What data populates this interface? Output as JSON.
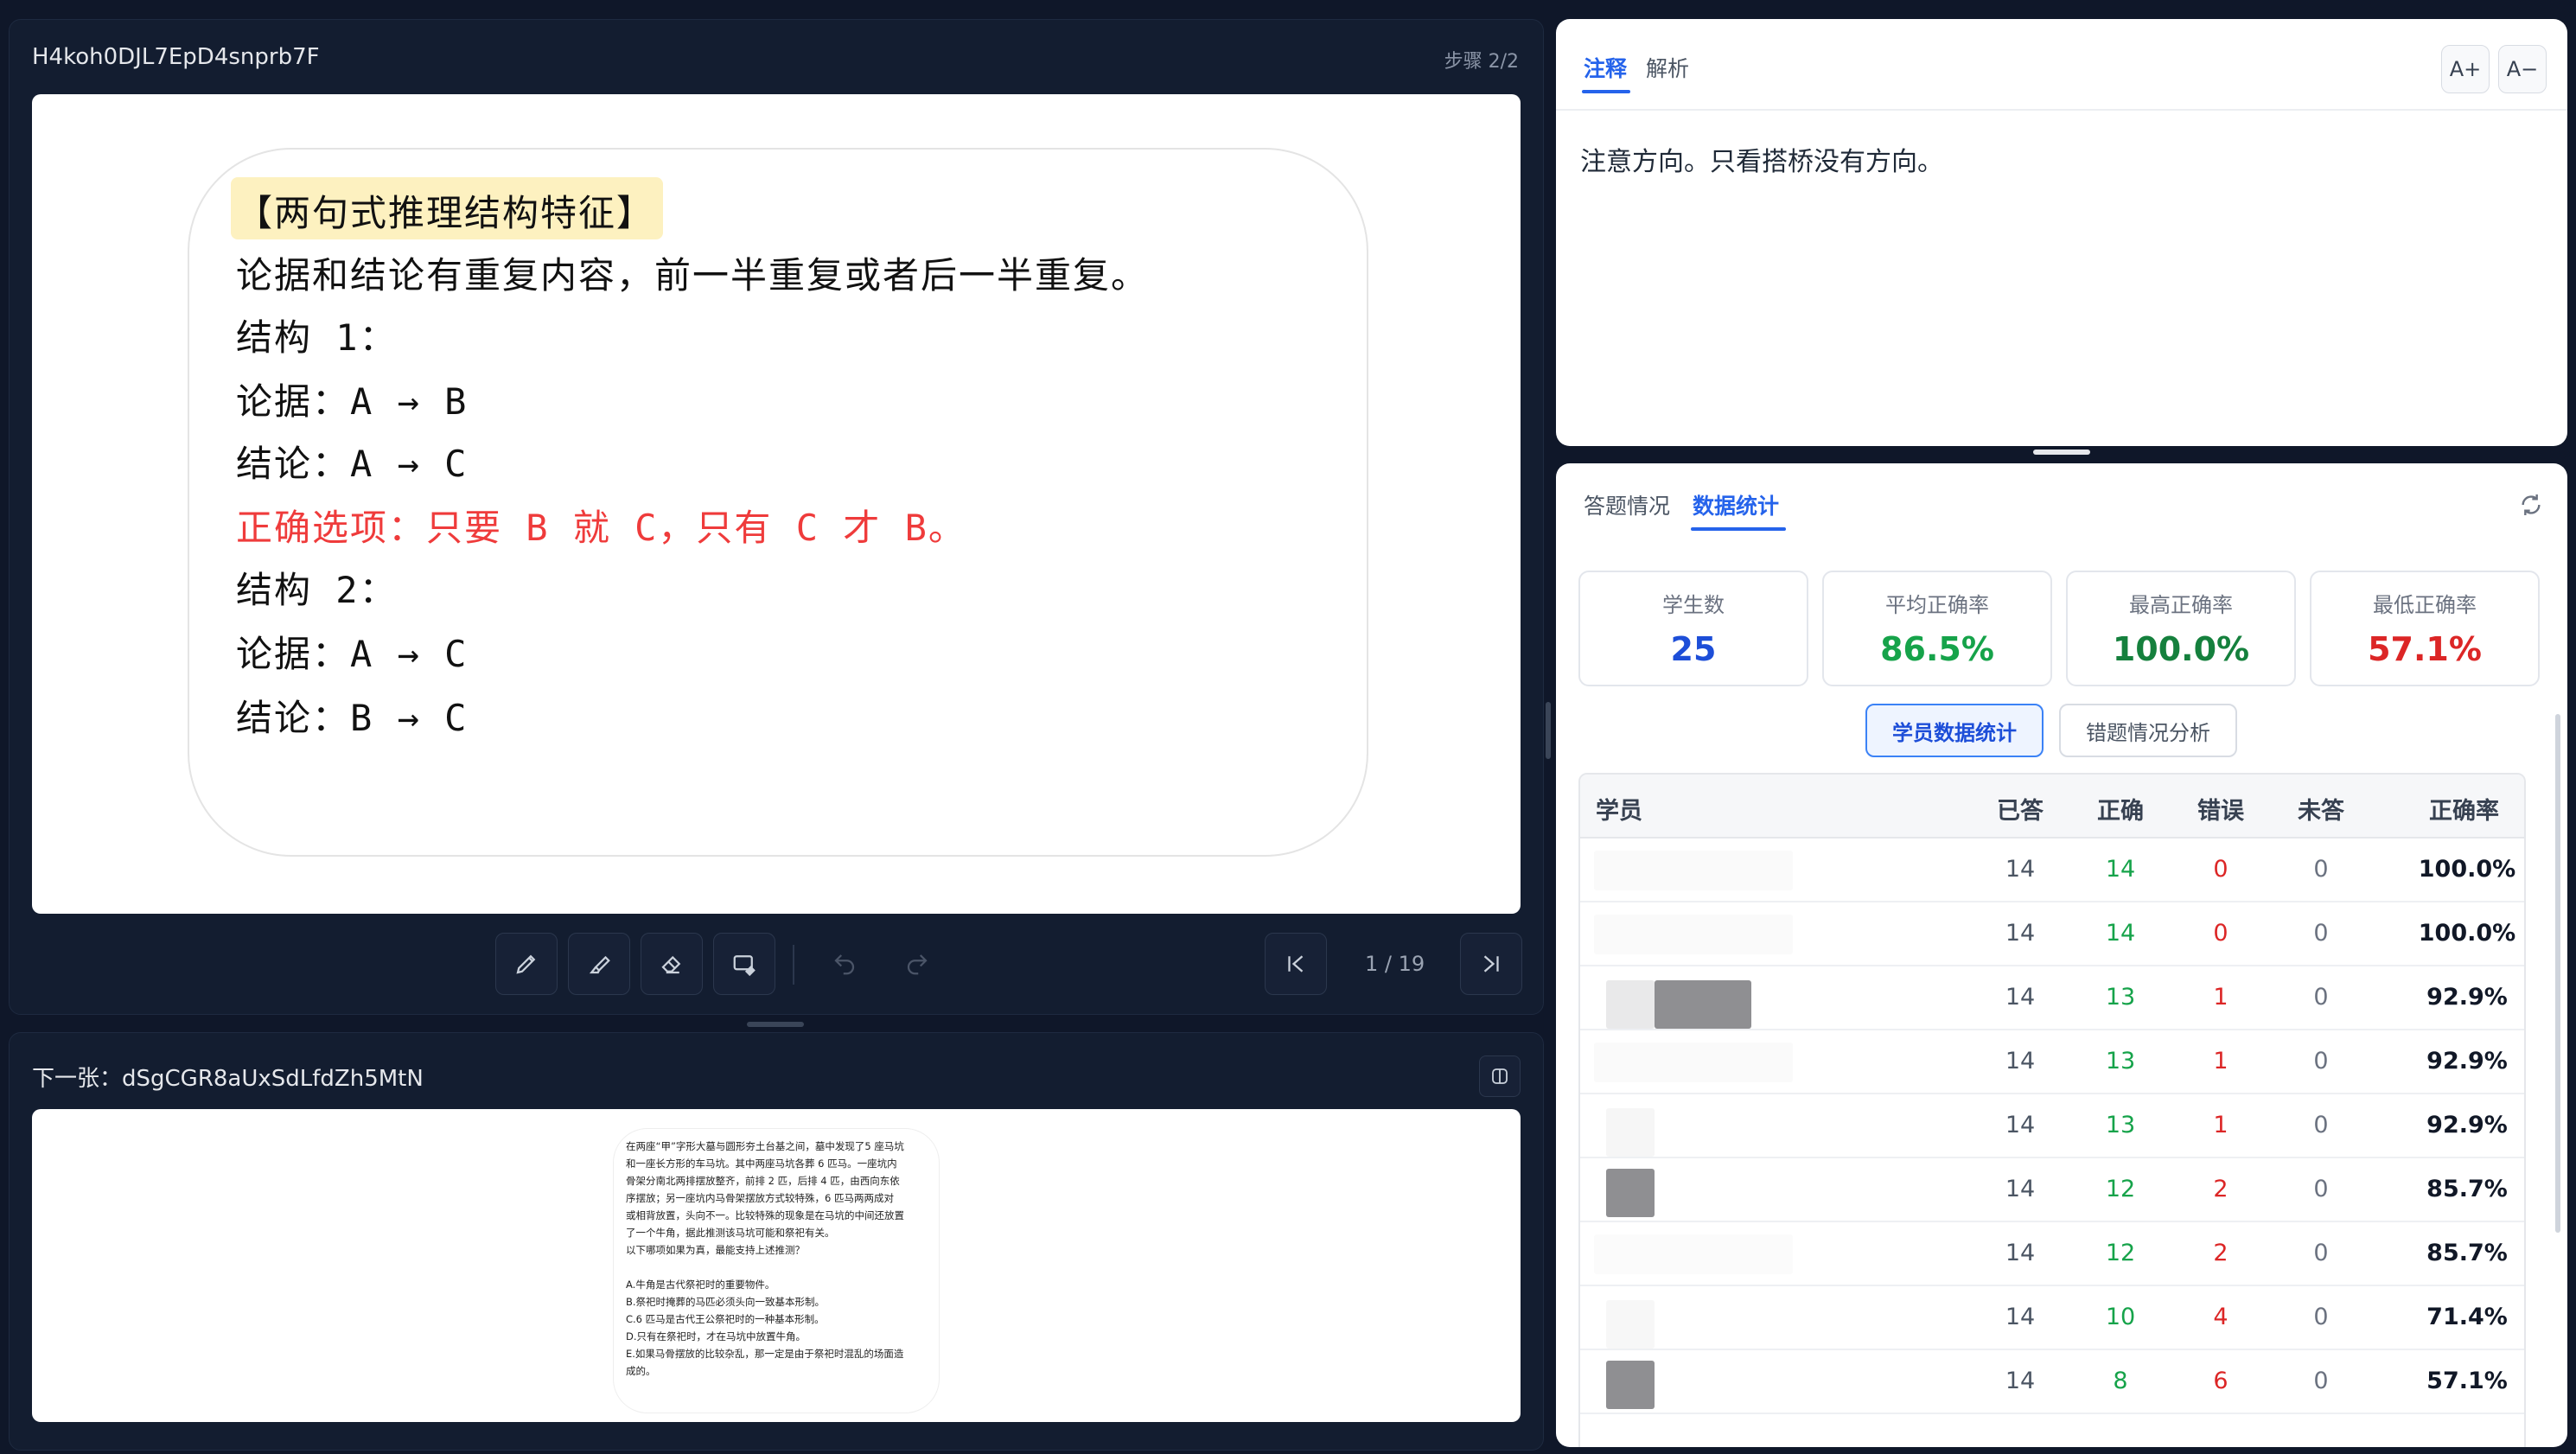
{
  "left": {
    "top_panel": {
      "title": "H4koh0DJL7EpD4snprb7F",
      "step": "步骤 2/2"
    },
    "handwriting": {
      "heading": "【两句式推理结构特征】",
      "lines": [
        "论据和结论有重复内容，前一半重复或者后一半重复。",
        "结构 1：",
        "论据：A → B",
        "结论：A → C",
        "正确选项：只要 B 就 C，只有 C 才 B。",
        "结构 2：",
        "论据：A → C",
        "结论：B → C"
      ]
    },
    "toolbar": {
      "tools": [
        {
          "name": "pencil-icon"
        },
        {
          "name": "highlighter-icon"
        },
        {
          "name": "eraser-icon"
        },
        {
          "name": "clear-board-icon"
        }
      ],
      "undo_icon": "undo-icon",
      "redo_icon": "redo-icon",
      "first_icon": "first-page-icon",
      "last_icon": "last-page-icon",
      "page": "1 / 19"
    },
    "bottom_panel": {
      "title": "下一张：dSgCGR8aUxSdLfdZh5MtN",
      "toggle_icon": "split-view-icon",
      "preview_lines": [
        "在两座“甲”字形大墓与圆形夯土台基之间，墓中发现了5 座马坑",
        "和一座长方形的车马坑。其中两座马坑各葬 6 匹马。一座坑内",
        "骨架分南北两排摆放整齐，前排 2 匹，后排 4 匹，由西向东依",
        "序摆放；另一座坑内马骨架摆放方式较特殊，6 匹马两两成对",
        "或相背放置，头向不一。比较特殊的现象是在马坑的中间还放置",
        "了一个牛角，据此推测该马坑可能和祭祀有关。",
        "以下哪项如果为真，最能支持上述推测？",
        "",
        "A.牛角是古代祭祀时的重要物件。",
        "B.祭祀时掩葬的马匹必须头向一致基本形制。",
        "C.6 匹马是古代王公祭祀时的一种基本形制。",
        "D.只有在祭祀时，才在马坑中放置牛角。",
        "E.如果马骨摆放的比较杂乱，那一定是由于祭祀时混乱的场面造",
        "成的。"
      ]
    }
  },
  "right": {
    "notes": {
      "tabs": [
        "注释",
        "解析"
      ],
      "active_tab": 0,
      "font_up": "A+",
      "font_down": "A−",
      "content": "注意方向。只看搭桥没有方向。"
    },
    "stats": {
      "tabs": [
        "答题情况",
        "数据统计"
      ],
      "active_tab": 1,
      "refresh_icon": "refresh-icon",
      "cards": [
        {
          "label": "学生数",
          "value": "25",
          "color": "#1d4ed8"
        },
        {
          "label": "平均正确率",
          "value": "86.5%",
          "color": "#16a34a"
        },
        {
          "label": "最高正确率",
          "value": "100.0%",
          "color": "#15803d"
        },
        {
          "label": "最低正确率",
          "value": "57.1%",
          "color": "#dc2626"
        }
      ],
      "sub_buttons": [
        "学员数据统计",
        "错题情况分析"
      ],
      "table": {
        "headers": [
          "学员",
          "已答",
          "正确",
          "错误",
          "未答",
          "正确率"
        ],
        "rows": [
          {
            "answered": "14",
            "correct": "14",
            "wrong": "0",
            "unanswered": "0",
            "rate": "100.0%"
          },
          {
            "answered": "14",
            "correct": "14",
            "wrong": "0",
            "unanswered": "0",
            "rate": "100.0%"
          },
          {
            "answered": "14",
            "correct": "13",
            "wrong": "1",
            "unanswered": "0",
            "rate": "92.9%"
          },
          {
            "answered": "14",
            "correct": "13",
            "wrong": "1",
            "unanswered": "0",
            "rate": "92.9%"
          },
          {
            "answered": "14",
            "correct": "13",
            "wrong": "1",
            "unanswered": "0",
            "rate": "92.9%"
          },
          {
            "answered": "14",
            "correct": "12",
            "wrong": "2",
            "unanswered": "0",
            "rate": "85.7%"
          },
          {
            "answered": "14",
            "correct": "12",
            "wrong": "2",
            "unanswered": "0",
            "rate": "85.7%"
          },
          {
            "answered": "14",
            "correct": "10",
            "wrong": "4",
            "unanswered": "0",
            "rate": "71.4%"
          },
          {
            "answered": "14",
            "correct": "8",
            "wrong": "6",
            "unanswered": "0",
            "rate": "57.1%"
          }
        ]
      }
    }
  }
}
